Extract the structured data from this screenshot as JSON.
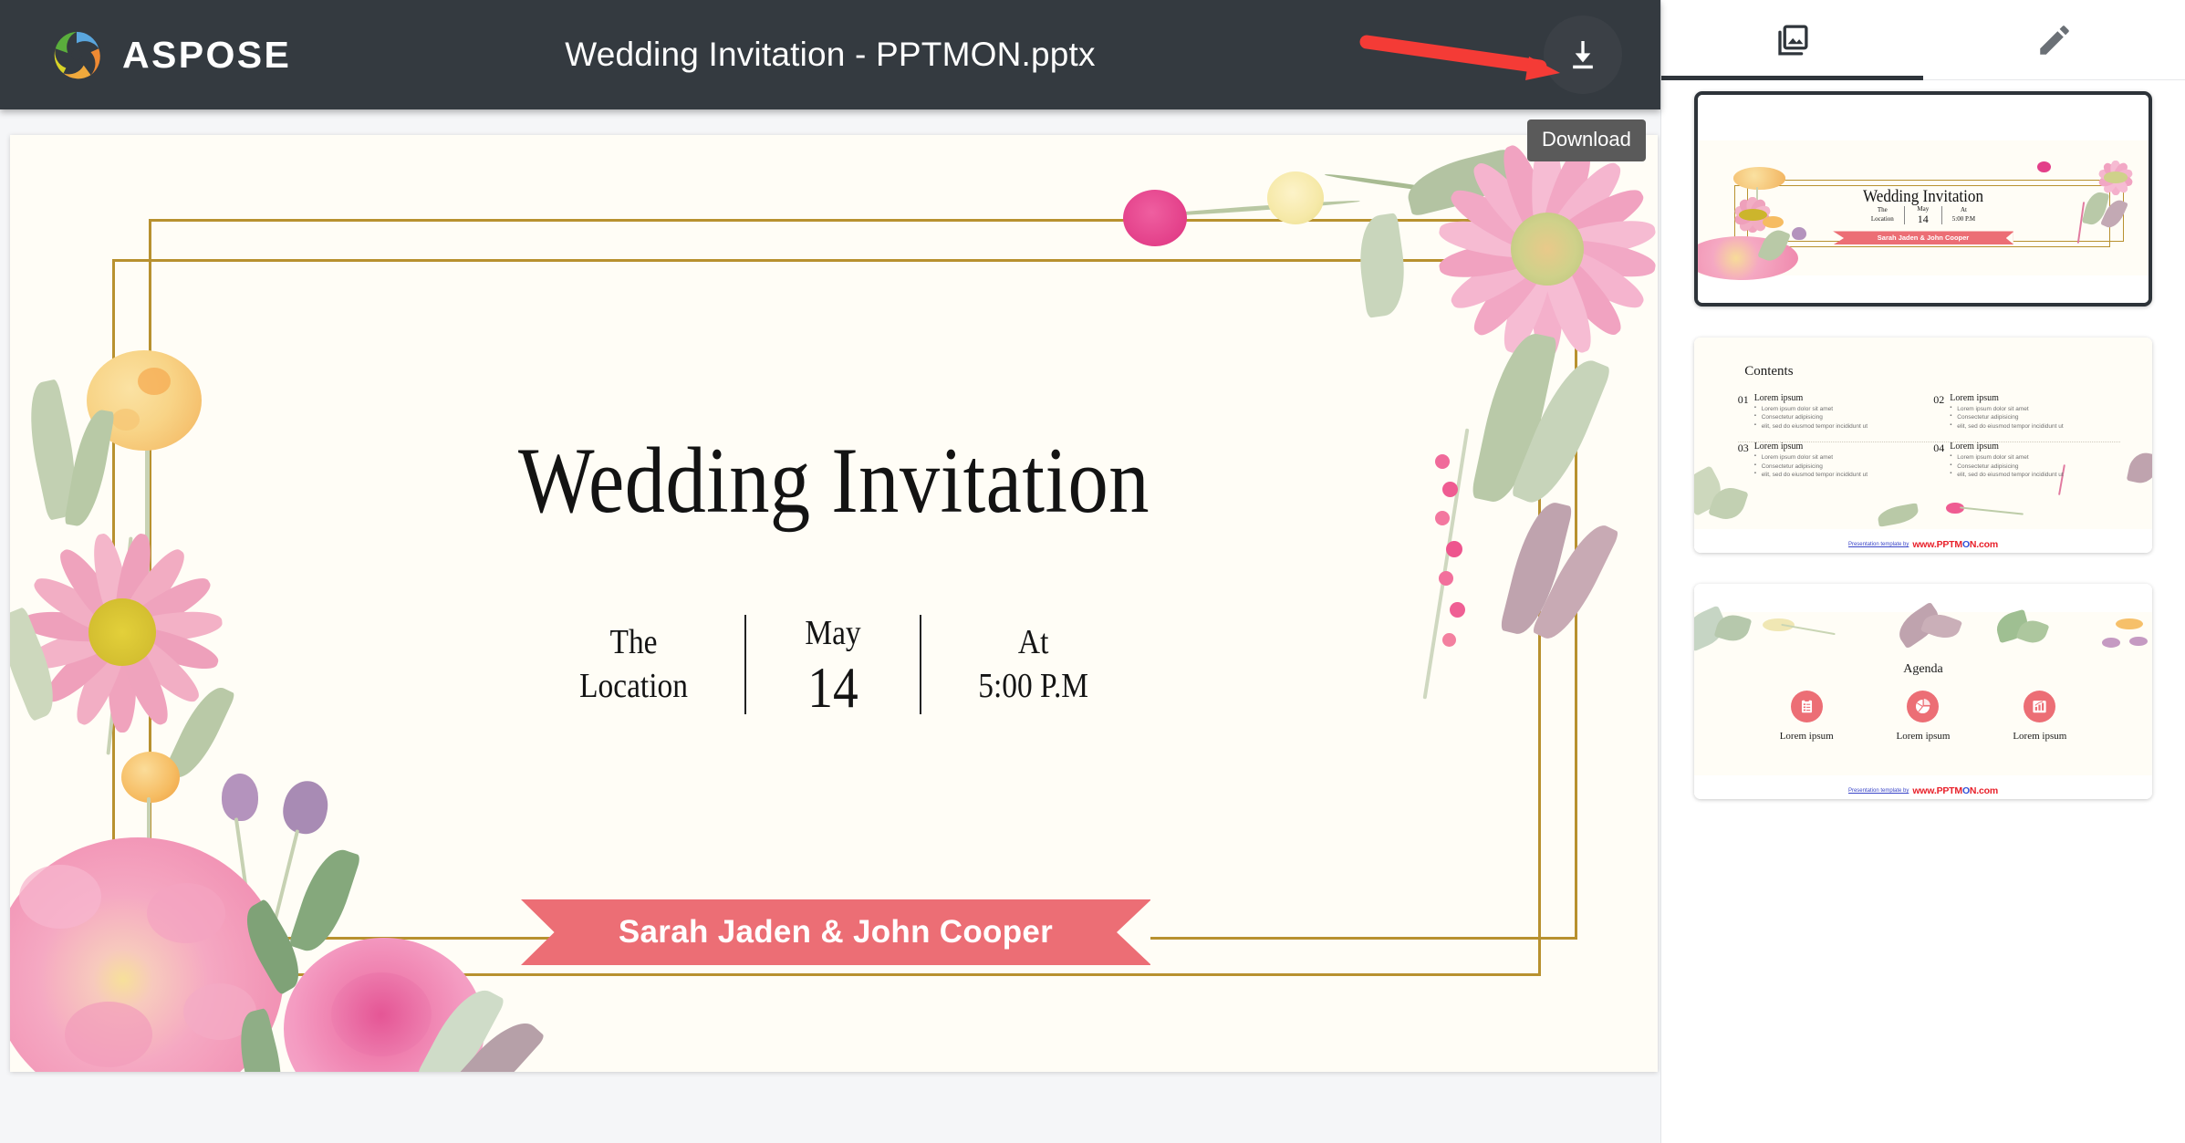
{
  "app": {
    "brand_name": "ASPOSE",
    "document_title": "Wedding Invitation - PPTMON.pptx",
    "download_tooltip": "Download",
    "accent_pink": "#ec6e75",
    "gold": "#b8912f",
    "topbar_bg": "#343a40",
    "annotation_arrow_color": "#f43b36"
  },
  "icons": {
    "logo": "aspose-spiral-logo",
    "download": "download-icon",
    "slides_tab": "slides-collection-icon",
    "edit_tab": "pencil-edit-icon"
  },
  "slide": {
    "title": "Wedding Invitation",
    "meta": [
      {
        "top": "The",
        "bottom": "Location",
        "emphasis": false
      },
      {
        "top": "May",
        "bottom": "14",
        "emphasis": true
      },
      {
        "top": "At",
        "bottom": "5:00 P.M",
        "emphasis": false
      }
    ],
    "ribbon_text": "Sarah Jaden & John Cooper"
  },
  "sidebar": {
    "tabs": [
      {
        "id": "slides",
        "icon": "slides-collection-icon",
        "active": true
      },
      {
        "id": "edit",
        "icon": "pencil-edit-icon",
        "active": false
      }
    ],
    "thumbnails": [
      {
        "index": 1,
        "selected": true,
        "kind": "title-slide",
        "title": "Wedding Invitation",
        "meta": [
          {
            "top": "The",
            "bottom": "Location"
          },
          {
            "top": "May",
            "bottom": "14"
          },
          {
            "top": "At",
            "bottom": "5:00 P.M"
          }
        ],
        "ribbon_text": "Sarah Jaden & John Cooper"
      },
      {
        "index": 2,
        "selected": false,
        "kind": "contents-slide",
        "title": "Contents",
        "items": [
          {
            "num": "01",
            "head": "Lorem ipsum",
            "bullets": [
              "Lorem ipsum dolor sit amet",
              "Consectetur adipisicing",
              "elit, sed do eiusmod tempor incididunt ut"
            ]
          },
          {
            "num": "02",
            "head": "Lorem ipsum",
            "bullets": [
              "Lorem ipsum dolor sit amet",
              "Consectetur adipisicing",
              "elit, sed do eiusmod tempor incididunt ut"
            ]
          },
          {
            "num": "03",
            "head": "Lorem ipsum",
            "bullets": [
              "Lorem ipsum dolor sit amet",
              "Consectetur adipisicing",
              "elit, sed do eiusmod tempor incididunt ut"
            ]
          },
          {
            "num": "04",
            "head": "Lorem ipsum",
            "bullets": [
              "Lorem ipsum dolor sit amet",
              "Consectetur adipisicing",
              "elit, sed do eiusmod tempor incididunt ut"
            ]
          }
        ],
        "footer_prefix": "Presentation template by",
        "footer_brand_a": "www.PPTM",
        "footer_brand_o": "O",
        "footer_brand_b": "N.com"
      },
      {
        "index": 3,
        "selected": false,
        "kind": "agenda-slide",
        "title": "Agenda",
        "cells": [
          {
            "icon": "clipboard-list-icon",
            "label": "Lorem ipsum"
          },
          {
            "icon": "pie-chart-icon",
            "label": "Lorem ipsum"
          },
          {
            "icon": "bar-chart-icon",
            "label": "Lorem ipsum"
          }
        ],
        "footer_prefix": "Presentation template by",
        "footer_brand_a": "www.PPTM",
        "footer_brand_o": "O",
        "footer_brand_b": "N.com"
      }
    ]
  }
}
